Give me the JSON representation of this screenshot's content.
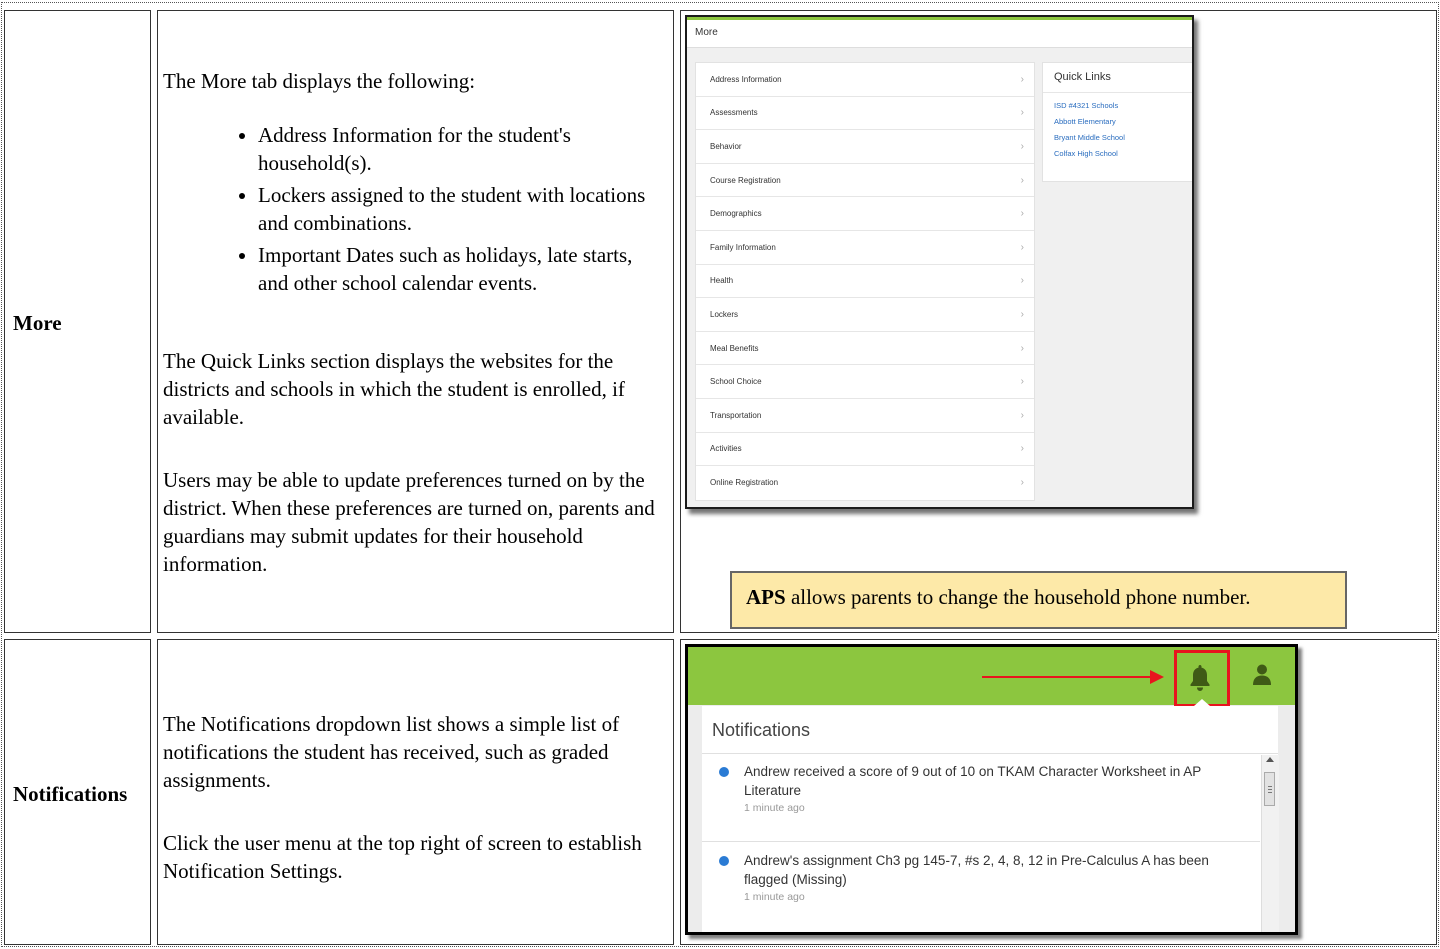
{
  "rows": [
    {
      "label": "More",
      "intro": "The More tab displays the following:",
      "bullets": [
        "Address Information for the student's household(s).",
        "Lockers assigned to the student with locations and combinations.",
        "Important Dates such as holidays, late starts, and other school calendar events."
      ],
      "para2": "The Quick Links section displays the websites for the districts and schools in which the student is enrolled, if available.",
      "para3": "Users may be able to update preferences turned on by the district. When these preferences are turned on, parents and guardians may submit updates for their household information."
    },
    {
      "label": "Notifications",
      "para1": "The Notifications dropdown list shows a simple list of notifications the student has received, such as graded assignments.",
      "para2": "Click the user menu at the top right of screen to establish Notification Settings."
    }
  ],
  "more_screen": {
    "header": "More",
    "menu_items": [
      "Address Information",
      "Assessments",
      "Behavior",
      "Course Registration",
      "Demographics",
      "Family Information",
      "Health",
      "Lockers",
      "Meal Benefits",
      "School Choice",
      "Transportation",
      "Activities",
      "Online Registration"
    ],
    "chevron": "›",
    "quick_links_title": "Quick Links",
    "quick_links": [
      "ISD #4321 Schools",
      "Abbott Elementary",
      "Bryant Middle School",
      "Colfax High School"
    ]
  },
  "note": {
    "bold": "APS",
    "rest": " allows parents to change the household phone number."
  },
  "notifications_screen": {
    "title": "Notifications",
    "items": [
      {
        "text": "Andrew received a score of 9 out of 10 on TKAM Character Worksheet in AP Literature",
        "time": "1 minute ago"
      },
      {
        "text": "Andrew's assignment Ch3 pg 145-7, #s 2, 4, 8, 12 in Pre-Calculus A has been flagged (Missing)",
        "time": "1 minute ago"
      }
    ]
  },
  "colors": {
    "green_bar": "#8cc63f",
    "highlight_red": "#e8141e",
    "note_bg": "#fde9a8",
    "link_blue": "#2a6dbf",
    "unread_dot": "#2a7bd4"
  }
}
